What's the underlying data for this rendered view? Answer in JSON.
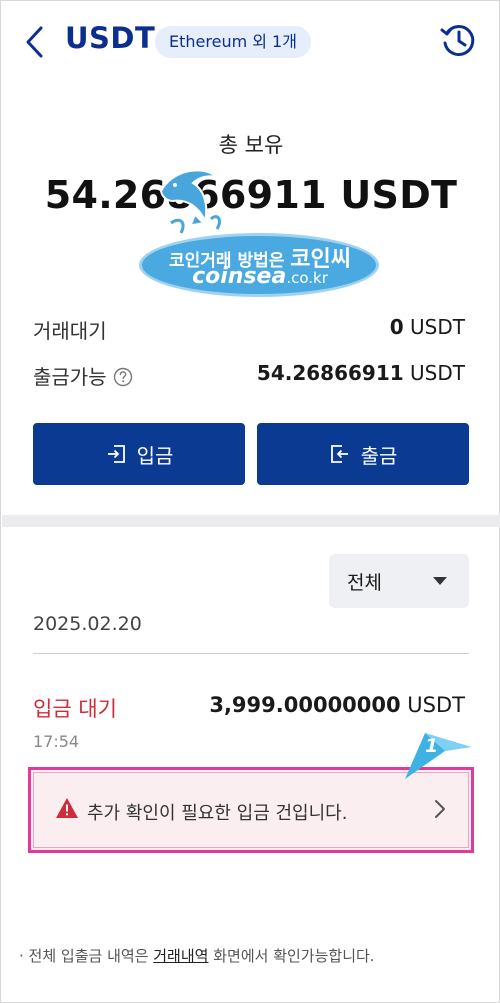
{
  "header": {
    "title": "USDT",
    "network_badge": "Ethereum 외 1개",
    "back_icon": "chevron-left-icon",
    "history_icon": "history-clock-icon"
  },
  "balance": {
    "total_label": "총 보유",
    "total_amount": "54.26866911 USDT"
  },
  "watermark": {
    "line1_prefix": "코인거래 방법은 ",
    "line1_brand": "코인씨",
    "line2_main": "coinsea",
    "line2_domain": ".co.kr"
  },
  "rows": {
    "pending_label": "거래대기",
    "pending_value": "0",
    "pending_unit": " USDT",
    "withdrawable_label": "출금가능",
    "withdrawable_value": "54.26866911",
    "withdrawable_unit": " USDT"
  },
  "actions": {
    "deposit_label": "입금",
    "withdraw_label": "출금"
  },
  "filter": {
    "selected": "전체"
  },
  "history": {
    "date": "2025.02.20",
    "item": {
      "status": "입금 대기",
      "amount": "3,999.00000000",
      "unit": " USDT",
      "time": "17:54"
    },
    "notice_text": "추가 확인이 필요한 입금 건입니다.",
    "step_number": "1"
  },
  "footer": {
    "prefix": "· 전체 입출금 내역은 ",
    "link": "거래내역",
    "suffix": " 화면에서 확인가능합니다."
  },
  "colors": {
    "brand_navy": "#0a3a92",
    "title_blue": "#0a2f8e",
    "pending_red": "#d02b3a",
    "highlight_pink": "#e23a9b",
    "badge_bg": "#e6eefb",
    "watermark_blue": "#4aa9e0"
  }
}
